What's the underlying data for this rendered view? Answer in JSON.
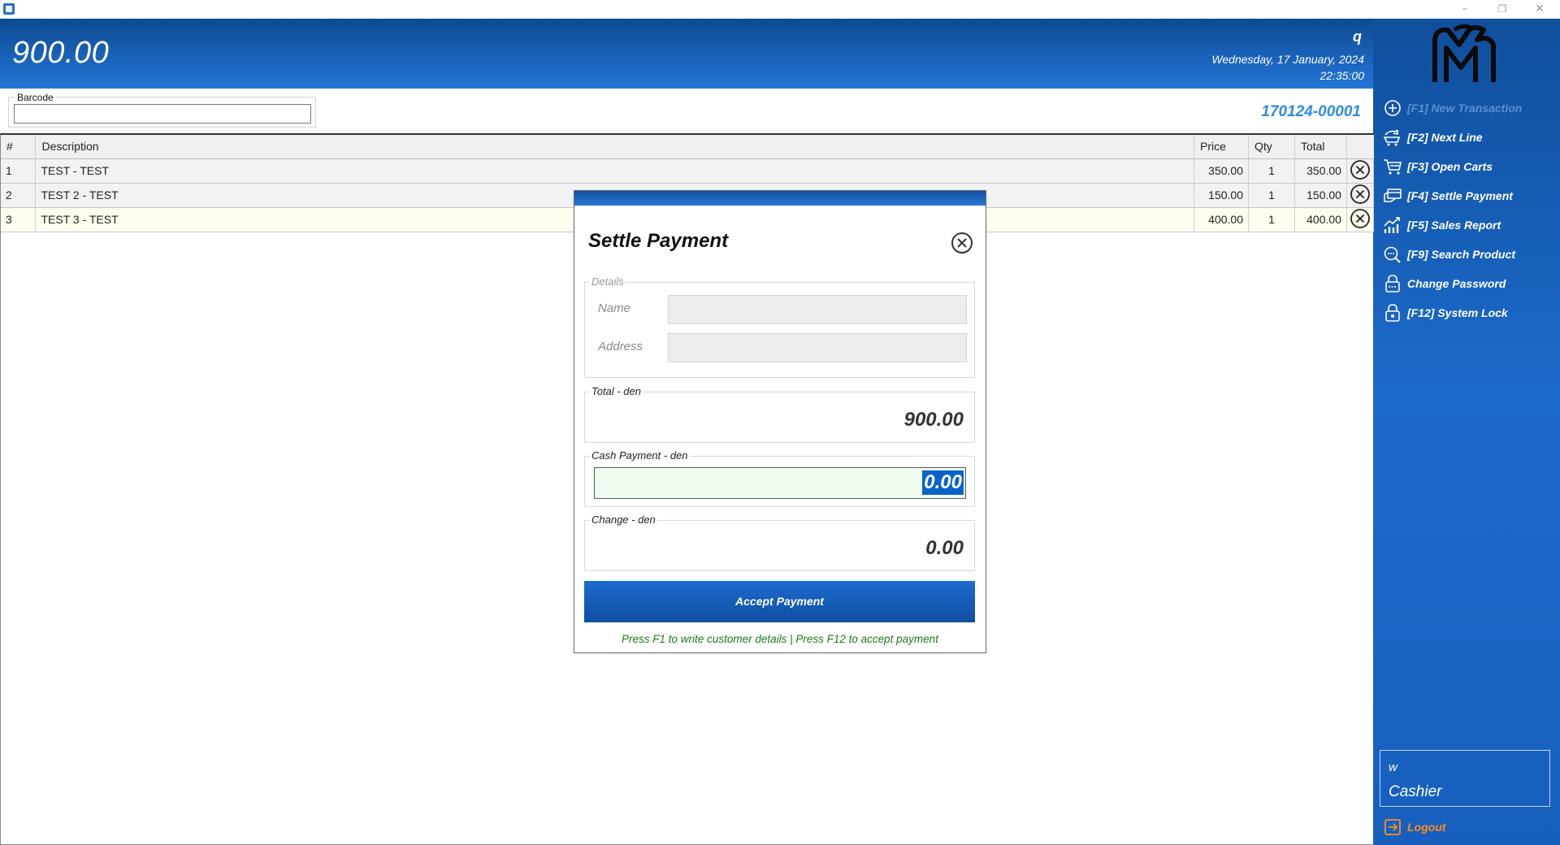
{
  "window": {
    "minimize_glyph": "–",
    "restore_glyph": "❐",
    "close_glyph": "✕"
  },
  "header": {
    "grand_total": "900.00",
    "user_initial": "q",
    "date": "Wednesday, 17 January, 2024",
    "time": "22:35:00"
  },
  "barcode": {
    "label": "Barcode",
    "value": ""
  },
  "transaction_number": "170124-00001",
  "table": {
    "columns": [
      "#",
      "Description",
      "Price",
      "Qty",
      "Total"
    ],
    "rows": [
      {
        "no": "1",
        "description": "TEST - TEST",
        "price": "350.00",
        "qty": "1",
        "total": "350.00"
      },
      {
        "no": "2",
        "description": "TEST 2 - TEST",
        "price": "150.00",
        "qty": "1",
        "total": "150.00"
      },
      {
        "no": "3",
        "description": "TEST 3 - TEST",
        "price": "400.00",
        "qty": "1",
        "total": "400.00"
      }
    ]
  },
  "sidebar": {
    "menu": [
      {
        "label": "[F1] New Transaction",
        "icon": "plus-circle-icon",
        "disabled": true
      },
      {
        "label": "[F2] Next Line",
        "icon": "cart-refresh-icon",
        "disabled": false
      },
      {
        "label": "[F3] Open Carts",
        "icon": "cart-icon",
        "disabled": false
      },
      {
        "label": "[F4] Settle Payment",
        "icon": "payment-icon",
        "disabled": false
      },
      {
        "label": "[F5] Sales Report",
        "icon": "chart-icon",
        "disabled": false
      },
      {
        "label": "[F9] Search Product",
        "icon": "search-icon",
        "disabled": false
      },
      {
        "label": "Change Password",
        "icon": "lock-icon",
        "disabled": false
      },
      {
        "label": "[F12] System Lock",
        "icon": "lock-closed-icon",
        "disabled": false
      }
    ],
    "user": {
      "name": "w",
      "role": "Cashier"
    },
    "logout_label": "Logout"
  },
  "modal": {
    "title": "Settle Payment",
    "details_legend": "Details",
    "name_label": "Name",
    "name_value": "",
    "address_label": "Address",
    "address_value": "",
    "total_legend": "Total - den",
    "total_value": "900.00",
    "cash_legend": "Cash Payment - den",
    "cash_value": "0.00",
    "change_legend": "Change - den",
    "change_value": "0.00",
    "accept_label": "Accept Payment",
    "hint": "Press F1 to write customer details | Press F12 to accept payment"
  },
  "colors": {
    "header_blue": "#1b64bd",
    "accent_blue": "#2d8ce6",
    "logout_orange": "#ff8c1a",
    "hint_green": "#1a7a1a"
  }
}
